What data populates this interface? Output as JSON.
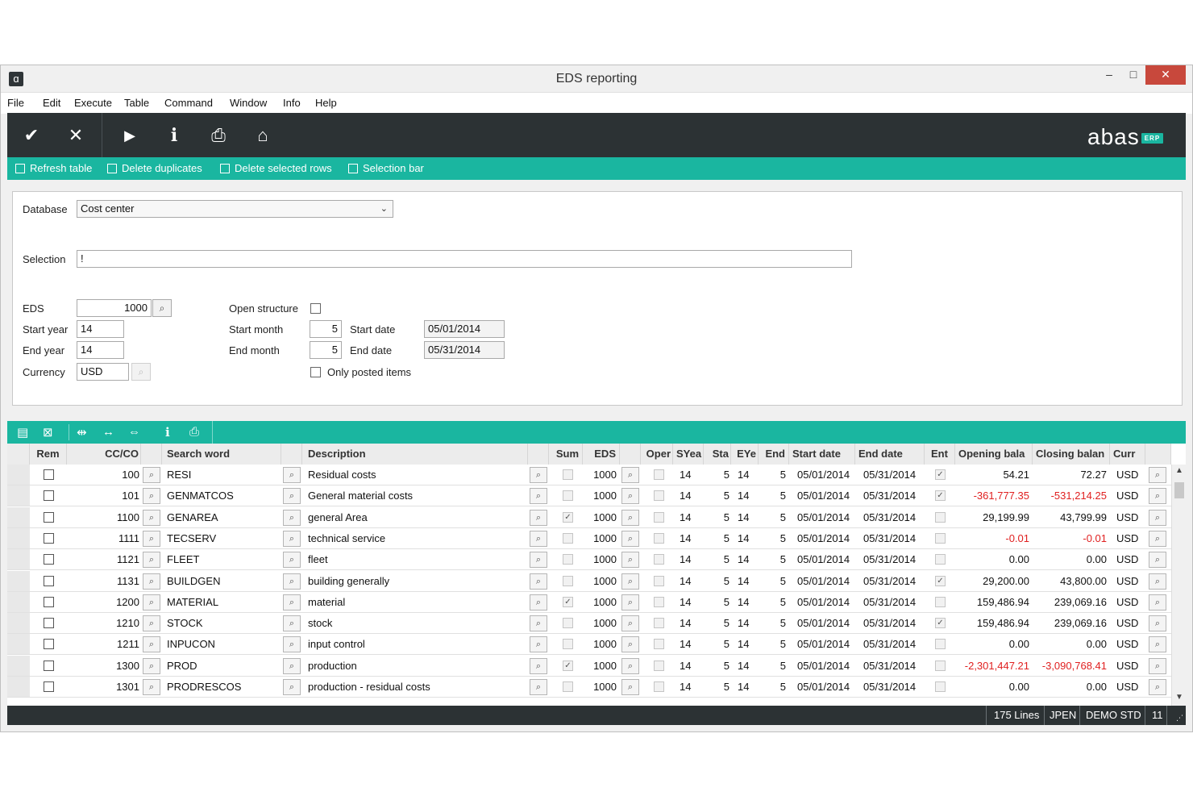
{
  "window": {
    "title": "EDS reporting",
    "app_icon": "abas-app-icon",
    "minimize": "–",
    "maximize": "□",
    "close": "✕"
  },
  "menu": [
    "File",
    "Edit",
    "Execute",
    "Table",
    "Command",
    "Window",
    "Info",
    "Help"
  ],
  "toolbar": {
    "buttons": [
      {
        "name": "confirm-icon",
        "glyph": "✔"
      },
      {
        "name": "cancel-icon",
        "glyph": "✕"
      },
      {
        "name": "play-icon",
        "glyph": "▶"
      },
      {
        "name": "info-icon",
        "glyph": "i"
      },
      {
        "name": "print-icon",
        "glyph": "⎙"
      },
      {
        "name": "home-icon",
        "glyph": "⌂"
      }
    ],
    "logo": "abas",
    "logo_badge": "ERP"
  },
  "actions": [
    "Refresh table",
    "Delete duplicates",
    "Delete selected rows",
    "Selection bar"
  ],
  "form": {
    "database_label": "Database",
    "database_value": "Cost center",
    "selection_label": "Selection",
    "selection_value": "!",
    "eds_label": "EDS",
    "eds_value": "1000",
    "start_year_label": "Start year",
    "start_year_value": "14",
    "end_year_label": "End year",
    "end_year_value": "14",
    "currency_label": "Currency",
    "currency_value": "USD",
    "open_structure_label": "Open structure",
    "open_structure_checked": false,
    "start_month_label": "Start month",
    "start_month_value": "5",
    "end_month_label": "End month",
    "end_month_value": "5",
    "start_date_label": "Start date",
    "start_date_value": "05/01/2014",
    "end_date_label": "End date",
    "end_date_value": "05/31/2014",
    "only_posted_label": "Only posted items",
    "only_posted_checked": false
  },
  "table_toolbar": [
    "insert-row-icon",
    "delete-row-icon",
    "fit-columns-icon",
    "expand-columns-icon",
    "shrink-columns-icon",
    "info-icon",
    "print-icon"
  ],
  "table": {
    "columns": [
      "Rem",
      "CC/CO",
      "Search word",
      "Description",
      "Sum",
      "EDS",
      "Oper",
      "SYea",
      "Sta",
      "EYe",
      "End",
      "Start date",
      "End date",
      "Ent",
      "Opening bala",
      "Closing balan",
      "Curr"
    ],
    "rows": [
      {
        "rem": false,
        "cc": "100",
        "search": "RESI",
        "desc": "Residual costs",
        "sum": false,
        "eds": "1000",
        "oper": false,
        "syear": "14",
        "sta": "5",
        "eyear": "14",
        "end": "5",
        "sdate": "05/01/2014",
        "edate": "05/31/2014",
        "ent": true,
        "open": "54.21",
        "close": "72.27",
        "curr": "USD"
      },
      {
        "rem": false,
        "cc": "101",
        "search": "GENMATCOS",
        "desc": "General material costs",
        "sum": false,
        "eds": "1000",
        "oper": false,
        "syear": "14",
        "sta": "5",
        "eyear": "14",
        "end": "5",
        "sdate": "05/01/2014",
        "edate": "05/31/2014",
        "ent": true,
        "open": "-361,777.35",
        "close": "-531,214.25",
        "curr": "USD"
      },
      {
        "rem": false,
        "cc": "1100",
        "search": "GENAREA",
        "desc": "general Area",
        "sum": true,
        "eds": "1000",
        "oper": false,
        "syear": "14",
        "sta": "5",
        "eyear": "14",
        "end": "5",
        "sdate": "05/01/2014",
        "edate": "05/31/2014",
        "ent": false,
        "open": "29,199.99",
        "close": "43,799.99",
        "curr": "USD"
      },
      {
        "rem": false,
        "cc": "1111",
        "search": "TECSERV",
        "desc": "technical service",
        "sum": false,
        "eds": "1000",
        "oper": false,
        "syear": "14",
        "sta": "5",
        "eyear": "14",
        "end": "5",
        "sdate": "05/01/2014",
        "edate": "05/31/2014",
        "ent": false,
        "open": "-0.01",
        "close": "-0.01",
        "curr": "USD"
      },
      {
        "rem": false,
        "cc": "1121",
        "search": "FLEET",
        "desc": "fleet",
        "sum": false,
        "eds": "1000",
        "oper": false,
        "syear": "14",
        "sta": "5",
        "eyear": "14",
        "end": "5",
        "sdate": "05/01/2014",
        "edate": "05/31/2014",
        "ent": false,
        "open": "0.00",
        "close": "0.00",
        "curr": "USD"
      },
      {
        "rem": false,
        "cc": "1131",
        "search": "BUILDGEN",
        "desc": "building generally",
        "sum": false,
        "eds": "1000",
        "oper": false,
        "syear": "14",
        "sta": "5",
        "eyear": "14",
        "end": "5",
        "sdate": "05/01/2014",
        "edate": "05/31/2014",
        "ent": true,
        "open": "29,200.00",
        "close": "43,800.00",
        "curr": "USD"
      },
      {
        "rem": false,
        "cc": "1200",
        "search": "MATERIAL",
        "desc": "material",
        "sum": true,
        "eds": "1000",
        "oper": false,
        "syear": "14",
        "sta": "5",
        "eyear": "14",
        "end": "5",
        "sdate": "05/01/2014",
        "edate": "05/31/2014",
        "ent": false,
        "open": "159,486.94",
        "close": "239,069.16",
        "curr": "USD"
      },
      {
        "rem": false,
        "cc": "1210",
        "search": "STOCK",
        "desc": "stock",
        "sum": false,
        "eds": "1000",
        "oper": false,
        "syear": "14",
        "sta": "5",
        "eyear": "14",
        "end": "5",
        "sdate": "05/01/2014",
        "edate": "05/31/2014",
        "ent": true,
        "open": "159,486.94",
        "close": "239,069.16",
        "curr": "USD"
      },
      {
        "rem": false,
        "cc": "1211",
        "search": "INPUCON",
        "desc": "input control",
        "sum": false,
        "eds": "1000",
        "oper": false,
        "syear": "14",
        "sta": "5",
        "eyear": "14",
        "end": "5",
        "sdate": "05/01/2014",
        "edate": "05/31/2014",
        "ent": false,
        "open": "0.00",
        "close": "0.00",
        "curr": "USD"
      },
      {
        "rem": false,
        "cc": "1300",
        "search": "PROD",
        "desc": "production",
        "sum": true,
        "eds": "1000",
        "oper": false,
        "syear": "14",
        "sta": "5",
        "eyear": "14",
        "end": "5",
        "sdate": "05/01/2014",
        "edate": "05/31/2014",
        "ent": false,
        "open": "-2,301,447.21",
        "close": "-3,090,768.41",
        "curr": "USD"
      },
      {
        "rem": false,
        "cc": "1301",
        "search": "PRODRESCOS",
        "desc": "production - residual costs",
        "sum": false,
        "eds": "1000",
        "oper": false,
        "syear": "14",
        "sta": "5",
        "eyear": "14",
        "end": "5",
        "sdate": "05/01/2014",
        "edate": "05/31/2014",
        "ent": false,
        "open": "0.00",
        "close": "0.00",
        "curr": "USD"
      }
    ]
  },
  "status": {
    "lines": "175 Lines",
    "user": "JPEN",
    "company": "DEMO STD",
    "number": "11"
  },
  "colors": {
    "accent": "#1ab6a0",
    "dark": "#2c3234",
    "negative": "#e02020"
  }
}
